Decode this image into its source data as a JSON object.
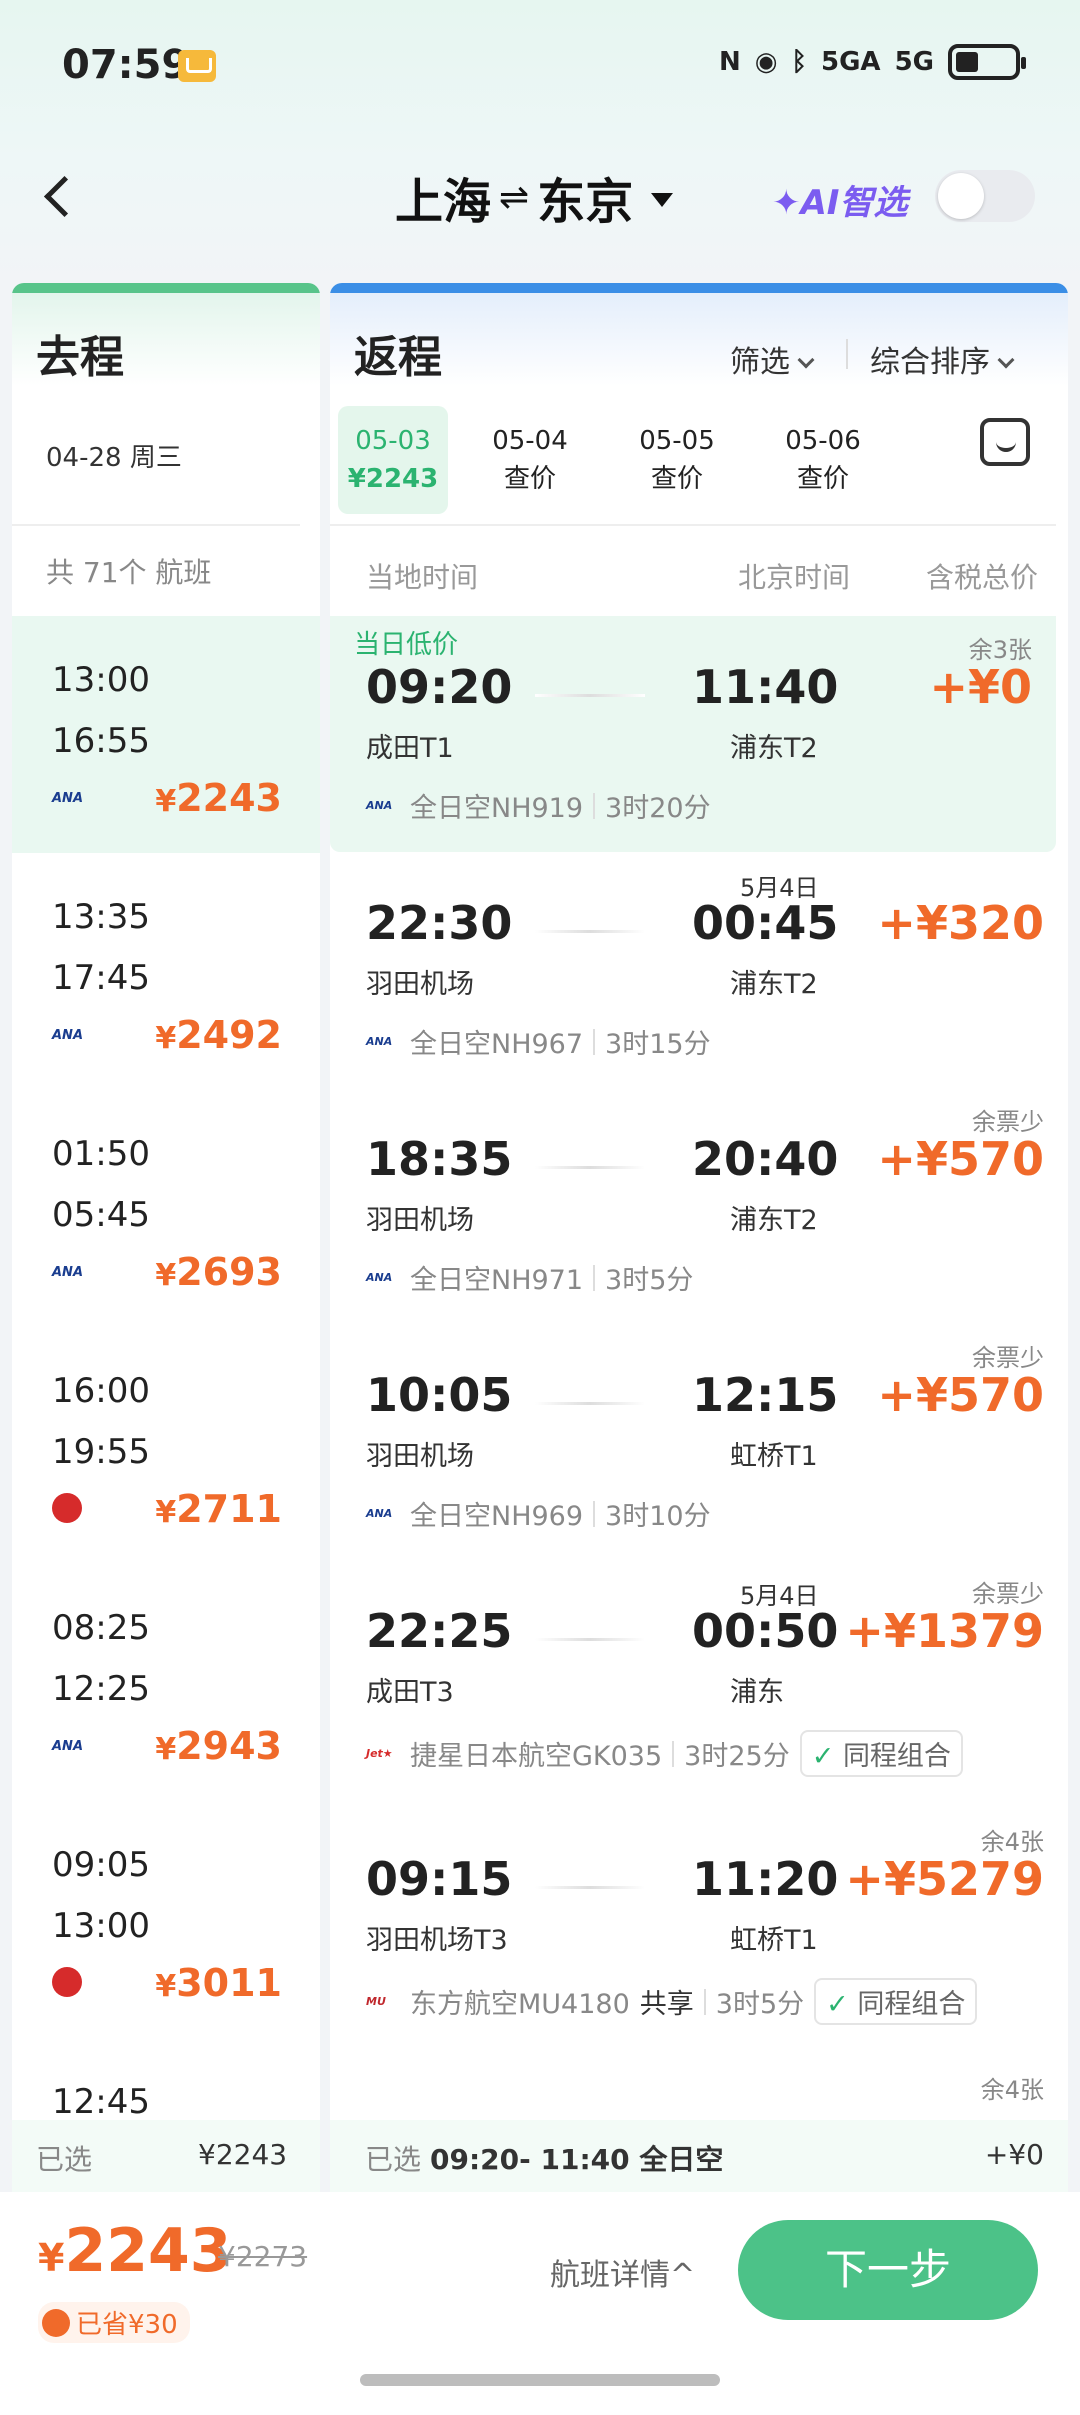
{
  "status": {
    "time": "07:59",
    "network1": "5GA",
    "network2": "5G"
  },
  "header": {
    "from": "上海",
    "arrows": "⇌",
    "to": "东京",
    "ai_label": "✦AI智选"
  },
  "outbound": {
    "title": "去程",
    "date": "04-28 周三",
    "count": "共 71个 航班",
    "items": [
      {
        "dep": "13:00",
        "arr": "16:55",
        "airline": "ANA",
        "price": "2243"
      },
      {
        "dep": "13:35",
        "arr": "17:45",
        "airline": "ANA",
        "price": "2492"
      },
      {
        "dep": "01:50",
        "arr": "05:45",
        "airline": "ANA",
        "price": "2693"
      },
      {
        "dep": "16:00",
        "arr": "19:55",
        "airline": "JAL",
        "price": "2711"
      },
      {
        "dep": "08:25",
        "arr": "12:25",
        "airline": "ANA",
        "price": "2943"
      },
      {
        "dep": "09:05",
        "arr": "13:00",
        "airline": "JAL",
        "price": "3011"
      },
      {
        "dep": "12:45",
        "arr": "",
        "airline": "",
        "price": ""
      }
    ]
  },
  "return": {
    "title": "返程",
    "filter_label": "筛选",
    "sort_label": "综合排序",
    "dates": [
      {
        "date": "05-03",
        "price": "¥2243"
      },
      {
        "date": "05-04",
        "price": "查价"
      },
      {
        "date": "05-05",
        "price": "查价"
      },
      {
        "date": "05-06",
        "price": "查价"
      }
    ],
    "columns": {
      "local": "当地时间",
      "beijing": "北京时间",
      "total": "含税总价"
    },
    "items": [
      {
        "badge": "当日低价",
        "dep": "09:20",
        "dep_airport": "成田T1",
        "arr": "11:40",
        "arr_airport": "浦东T2",
        "next_day": "",
        "avail": "余3张",
        "price": "+¥0",
        "airline_logo": "ANA",
        "flight": "全日空NH919",
        "share": "",
        "duration": "3时20分",
        "combo": ""
      },
      {
        "badge": "",
        "dep": "22:30",
        "dep_airport": "羽田机场",
        "arr": "00:45",
        "arr_airport": "浦东T2",
        "next_day": "5月4日",
        "avail": "",
        "price": "+¥320",
        "airline_logo": "ANA",
        "flight": "全日空NH967",
        "share": "",
        "duration": "3时15分",
        "combo": ""
      },
      {
        "badge": "",
        "dep": "18:35",
        "dep_airport": "羽田机场",
        "arr": "20:40",
        "arr_airport": "浦东T2",
        "next_day": "",
        "avail": "余票少",
        "price": "+¥570",
        "airline_logo": "ANA",
        "flight": "全日空NH971",
        "share": "",
        "duration": "3时5分",
        "combo": ""
      },
      {
        "badge": "",
        "dep": "10:05",
        "dep_airport": "羽田机场",
        "arr": "12:15",
        "arr_airport": "虹桥T1",
        "next_day": "",
        "avail": "余票少",
        "price": "+¥570",
        "airline_logo": "ANA",
        "flight": "全日空NH969",
        "share": "",
        "duration": "3时10分",
        "combo": ""
      },
      {
        "badge": "",
        "dep": "22:25",
        "dep_airport": "成田T3",
        "arr": "00:50",
        "arr_airport": "浦东",
        "next_day": "5月4日",
        "avail": "余票少",
        "price": "+¥1379",
        "airline_logo": "Jet★",
        "flight": "捷星日本航空GK035",
        "share": "",
        "duration": "3时25分",
        "combo": "同程组合"
      },
      {
        "badge": "",
        "dep": "09:15",
        "dep_airport": "羽田机场T3",
        "arr": "11:20",
        "arr_airport": "虹桥T1",
        "next_day": "",
        "avail": "余4张",
        "price": "+¥5279",
        "airline_logo": "MU",
        "flight": "东方航空MU4180",
        "share": "共享",
        "duration": "3时5分",
        "combo": "同程组合"
      },
      {
        "badge": "",
        "dep": "",
        "dep_airport": "",
        "arr": "",
        "arr_airport": "",
        "next_day": "",
        "avail": "余4张",
        "price": "",
        "airline_logo": "",
        "flight": "",
        "share": "",
        "duration": "",
        "combo": ""
      }
    ]
  },
  "selected": {
    "label": "已选",
    "out_price": "¥2243",
    "ret_info": "09:20- 11:40 全日空",
    "ret_price": "+¥0"
  },
  "bottom": {
    "total": "2243",
    "currency": "¥",
    "original": "¥2273",
    "saved": "已省¥30",
    "detail_label": "航班详情^",
    "next_label": "下一步"
  },
  "colors": {
    "accent_green": "#4cc288",
    "price_orange": "#f06a2a",
    "return_blue": "#3b8ee6"
  }
}
